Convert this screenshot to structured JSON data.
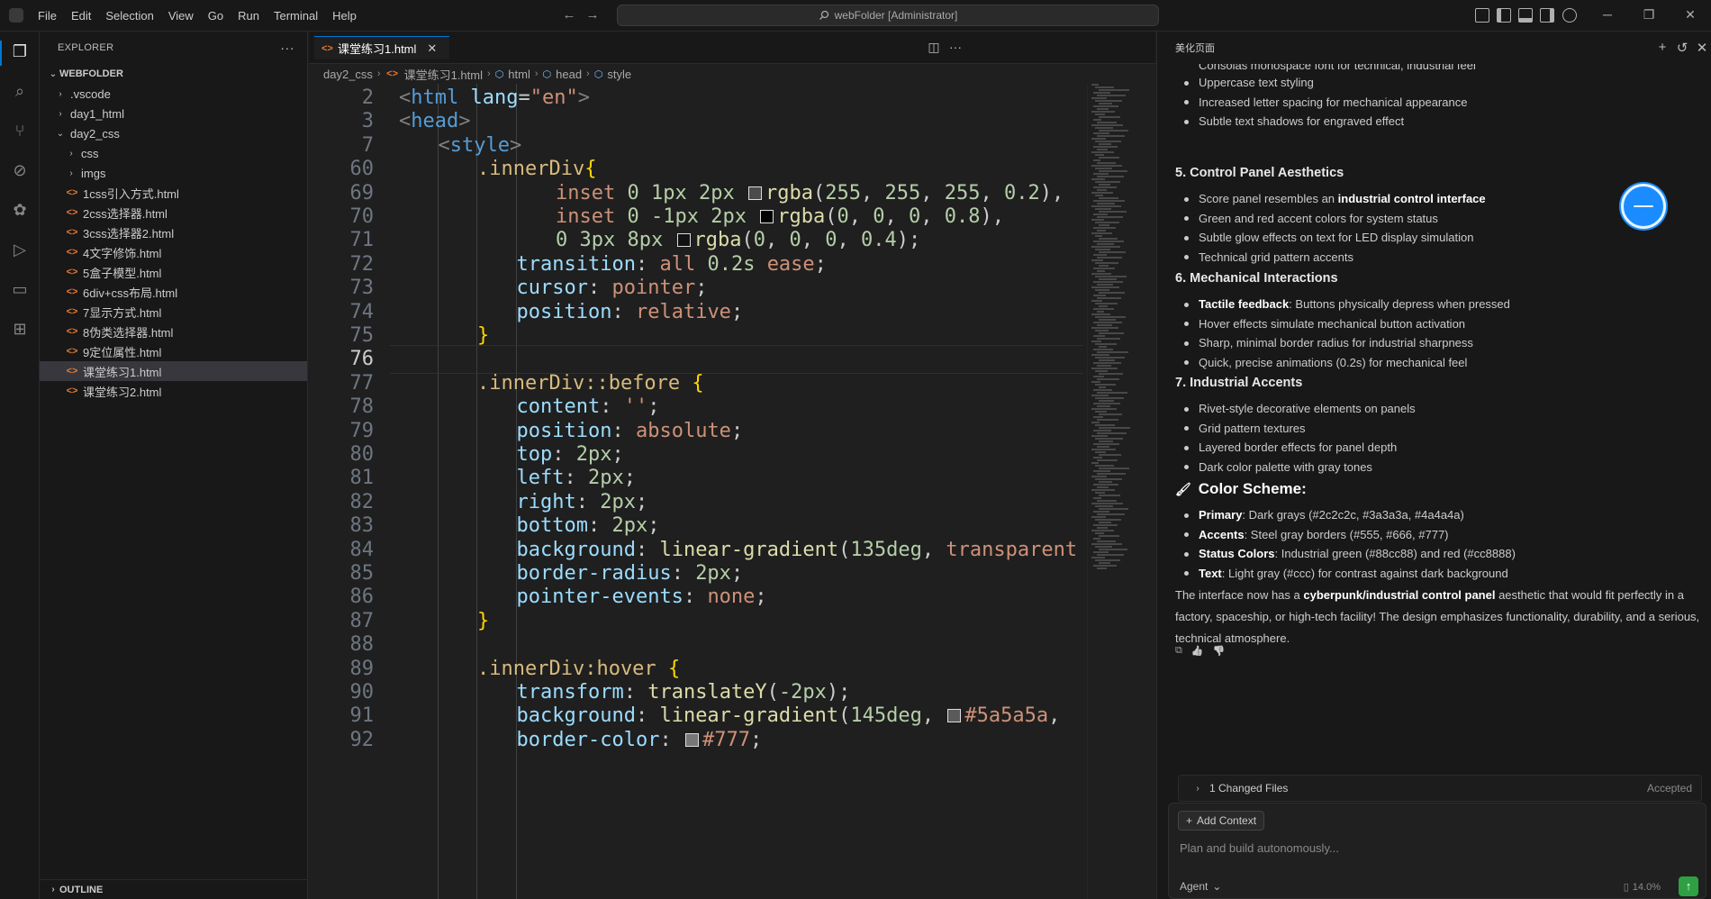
{
  "menu": [
    "File",
    "Edit",
    "Selection",
    "View",
    "Go",
    "Run",
    "Terminal",
    "Help"
  ],
  "command_center": "webFolder [Administrator]",
  "sidebar": {
    "title": "EXPLORER",
    "folder": "WEBFOLDER",
    "tree": [
      {
        "label": ".vscode",
        "kind": "folder",
        "depth": 1,
        "expanded": false
      },
      {
        "label": "day1_html",
        "kind": "folder",
        "depth": 1,
        "expanded": false
      },
      {
        "label": "day2_css",
        "kind": "folder",
        "depth": 1,
        "expanded": true
      },
      {
        "label": "css",
        "kind": "folder",
        "depth": 2,
        "expanded": false
      },
      {
        "label": "imgs",
        "kind": "folder",
        "depth": 2,
        "expanded": false
      },
      {
        "label": "1css引入方式.html",
        "kind": "file",
        "depth": 2
      },
      {
        "label": "2css选择器.html",
        "kind": "file",
        "depth": 2
      },
      {
        "label": "3css选择器2.html",
        "kind": "file",
        "depth": 2
      },
      {
        "label": "4文字修饰.html",
        "kind": "file",
        "depth": 2
      },
      {
        "label": "5盒子模型.html",
        "kind": "file",
        "depth": 2
      },
      {
        "label": "6div+css布局.html",
        "kind": "file",
        "depth": 2
      },
      {
        "label": "7显示方式.html",
        "kind": "file",
        "depth": 2
      },
      {
        "label": "8伪类选择器.html",
        "kind": "file",
        "depth": 2
      },
      {
        "label": "9定位属性.html",
        "kind": "file",
        "depth": 2
      },
      {
        "label": "课堂练习1.html",
        "kind": "file",
        "depth": 2,
        "selected": true
      },
      {
        "label": "课堂练习2.html",
        "kind": "file",
        "depth": 2
      }
    ],
    "outline": "OUTLINE"
  },
  "editor": {
    "tab": "课堂练习1.html",
    "breadcrumb": [
      "day2_css",
      "课堂练习1.html",
      "html",
      "head",
      "style"
    ],
    "current_line": "76",
    "lines": [
      {
        "n": "2",
        "indent": 0,
        "html": "<span class=\"t-br\">&lt;</span><span class=\"t-tag\">html</span> <span class=\"t-attr\">lang</span><span class=\"t-punc\">=</span><span class=\"t-str\">\"en\"</span><span class=\"t-br\">&gt;</span>"
      },
      {
        "n": "3",
        "indent": 0,
        "html": "<span class=\"t-br\">&lt;</span><span class=\"t-tag\">head</span><span class=\"t-br\">&gt;</span>"
      },
      {
        "n": "7",
        "indent": 1,
        "html": "<span class=\"t-br\">&lt;</span><span class=\"t-tag\">style</span><span class=\"t-br\">&gt;</span>"
      },
      {
        "n": "60",
        "indent": 2,
        "html": "<span class=\"t-sel\">.innerDiv</span><span class=\"t-brace\">{</span>"
      },
      {
        "n": "69",
        "indent": 4,
        "html": "<span class=\"t-val\">inset</span> <span class=\"t-num\">0</span> <span class=\"t-num\">1px</span> <span class=\"t-num\">2px</span> <span class=\"swatch\" style=\"background:rgba(255,255,255,0.2)\"></span><span class=\"t-fn\">rgba</span><span class=\"t-punc\">(</span><span class=\"t-num\">255</span>, <span class=\"t-num\">255</span>, <span class=\"t-num\">255</span>, <span class=\"t-num\">0.2</span><span class=\"t-punc\">)</span>,"
      },
      {
        "n": "70",
        "indent": 4,
        "html": "<span class=\"t-val\">inset</span> <span class=\"t-num\">0</span> <span class=\"t-num\">-1px</span> <span class=\"t-num\">2px</span> <span class=\"swatch\" style=\"background:#000\"></span><span class=\"t-fn\">rgba</span><span class=\"t-punc\">(</span><span class=\"t-num\">0</span>, <span class=\"t-num\">0</span>, <span class=\"t-num\">0</span>, <span class=\"t-num\">0.8</span><span class=\"t-punc\">)</span>,"
      },
      {
        "n": "71",
        "indent": 4,
        "html": "<span class=\"t-num\">0</span> <span class=\"t-num\">3px</span> <span class=\"t-num\">8px</span> <span class=\"swatch\" style=\"background:rgba(0,0,0,0.4)\"></span><span class=\"t-fn\">rgba</span><span class=\"t-punc\">(</span><span class=\"t-num\">0</span>, <span class=\"t-num\">0</span>, <span class=\"t-num\">0</span>, <span class=\"t-num\">0.4</span><span class=\"t-punc\">)</span>;"
      },
      {
        "n": "72",
        "indent": 3,
        "html": "<span class=\"t-prop\">transition</span>: <span class=\"t-val\">all</span> <span class=\"t-num\">0.2s</span> <span class=\"t-val\">ease</span>;"
      },
      {
        "n": "73",
        "indent": 3,
        "html": "<span class=\"t-prop\">cursor</span>: <span class=\"t-val\">pointer</span>;"
      },
      {
        "n": "74",
        "indent": 3,
        "html": "<span class=\"t-prop\">position</span>: <span class=\"t-val\">relative</span>;"
      },
      {
        "n": "75",
        "indent": 2,
        "html": "<span class=\"t-brace\">}</span>"
      },
      {
        "n": "76",
        "indent": 0,
        "html": ""
      },
      {
        "n": "77",
        "indent": 2,
        "html": "<span class=\"t-sel\">.innerDiv::before</span> <span class=\"t-brace\">{</span>"
      },
      {
        "n": "78",
        "indent": 3,
        "html": "<span class=\"t-prop\">content</span>: <span class=\"t-str\">''</span>;"
      },
      {
        "n": "79",
        "indent": 3,
        "html": "<span class=\"t-prop\">position</span>: <span class=\"t-val\">absolute</span>;"
      },
      {
        "n": "80",
        "indent": 3,
        "html": "<span class=\"t-prop\">top</span>: <span class=\"t-num\">2px</span>;"
      },
      {
        "n": "81",
        "indent": 3,
        "html": "<span class=\"t-prop\">left</span>: <span class=\"t-num\">2px</span>;"
      },
      {
        "n": "82",
        "indent": 3,
        "html": "<span class=\"t-prop\">right</span>: <span class=\"t-num\">2px</span>;"
      },
      {
        "n": "83",
        "indent": 3,
        "html": "<span class=\"t-prop\">bottom</span>: <span class=\"t-num\">2px</span>;"
      },
      {
        "n": "84",
        "indent": 3,
        "html": "<span class=\"t-prop\">background</span>: <span class=\"t-fn\">linear-gradient</span><span class=\"t-punc\">(</span><span class=\"t-num\">135deg</span>, <span class=\"t-val\">transparent</span>"
      },
      {
        "n": "85",
        "indent": 3,
        "html": "<span class=\"t-prop\">border-radius</span>: <span class=\"t-num\">2px</span>;"
      },
      {
        "n": "86",
        "indent": 3,
        "html": "<span class=\"t-prop\">pointer-events</span>: <span class=\"t-val\">none</span>;"
      },
      {
        "n": "87",
        "indent": 2,
        "html": "<span class=\"t-brace\">}</span>"
      },
      {
        "n": "88",
        "indent": 0,
        "html": ""
      },
      {
        "n": "89",
        "indent": 2,
        "html": "<span class=\"t-sel\">.innerDiv:hover</span> <span class=\"t-brace\">{</span>"
      },
      {
        "n": "90",
        "indent": 3,
        "html": "<span class=\"t-prop\">transform</span>: <span class=\"t-fn\">translateY</span><span class=\"t-punc\">(</span><span class=\"t-num\">-2px</span><span class=\"t-punc\">)</span>;"
      },
      {
        "n": "91",
        "indent": 3,
        "html": "<span class=\"t-prop\">background</span>: <span class=\"t-fn\">linear-gradient</span><span class=\"t-punc\">(</span><span class=\"t-num\">145deg</span>, <span class=\"swatch\" style=\"background:#5a5a5a\"></span><span class=\"t-val\">#5a5a5a</span>,"
      },
      {
        "n": "92",
        "indent": 3,
        "html": "<span class=\"t-prop\">border-color</span>: <span class=\"swatch\" style=\"background:#777\"></span><span class=\"t-val\">#777</span>;"
      }
    ]
  },
  "chat": {
    "title": "美化页面",
    "top_cut_text": "Consolas monospace font for technical, industrial feel",
    "intro_items": [
      {
        "text": "Uppercase text styling"
      },
      {
        "text": "Increased letter spacing for mechanical appearance"
      },
      {
        "text": "Subtle text shadows for engraved effect"
      }
    ],
    "sections": [
      {
        "heading": "5. Control Panel Aesthetics",
        "items": [
          {
            "pre": "Score panel resembles an ",
            "bold": "industrial control interface",
            "post": ""
          },
          {
            "pre": "Green and red accent colors for system status",
            "bold": "",
            "post": ""
          },
          {
            "pre": "Subtle glow effects on text for LED display simulation",
            "bold": "",
            "post": ""
          },
          {
            "pre": "Technical grid pattern accents",
            "bold": "",
            "post": ""
          }
        ]
      },
      {
        "heading": "6. Mechanical Interactions",
        "items": [
          {
            "pre": "",
            "bold": "Tactile feedback",
            "post": ": Buttons physically depress when pressed"
          },
          {
            "pre": "Hover effects simulate mechanical button activation",
            "bold": "",
            "post": ""
          },
          {
            "pre": "Sharp, minimal border radius for industrial sharpness",
            "bold": "",
            "post": ""
          },
          {
            "pre": "Quick, precise animations (0.2s) for mechanical feel",
            "bold": "",
            "post": ""
          }
        ]
      },
      {
        "heading": "7. Industrial Accents",
        "items": [
          {
            "pre": "Rivet-style decorative elements on panels",
            "bold": "",
            "post": ""
          },
          {
            "pre": "Grid pattern textures",
            "bold": "",
            "post": ""
          },
          {
            "pre": "Layered border effects for panel depth",
            "bold": "",
            "post": ""
          },
          {
            "pre": "Dark color palette with gray tones",
            "bold": "",
            "post": ""
          }
        ]
      }
    ],
    "color_scheme": {
      "heading": "Color Scheme:",
      "items": [
        {
          "bold": "Primary",
          "post": ": Dark grays (#2c2c2c, #3a3a3a, #4a4a4a)"
        },
        {
          "bold": "Accents",
          "post": ": Steel gray borders (#555, #666, #777)"
        },
        {
          "bold": "Status Colors",
          "post": ": Industrial green (#88cc88) and red (#cc8888)"
        },
        {
          "bold": "Text",
          "post": ": Light gray (#ccc) for contrast against dark background"
        }
      ]
    },
    "summary": {
      "pre": "The interface now has a ",
      "bold": "cyberpunk/industrial control panel",
      "post": " aesthetic that would fit perfectly in a factory, spaceship, or high-tech facility! The design emphasizes functionality, durability, and a serious, technical atmosphere."
    },
    "changed_files": "1 Changed Files",
    "changed_status": "Accepted",
    "add_context": "Add Context",
    "input_placeholder": "Plan and build autonomously...",
    "mode": "Agent",
    "usage": "14.0%"
  },
  "colors": {
    "accent": "#0078d4",
    "send": "#2ea043",
    "float_button": "#1a8cff"
  }
}
